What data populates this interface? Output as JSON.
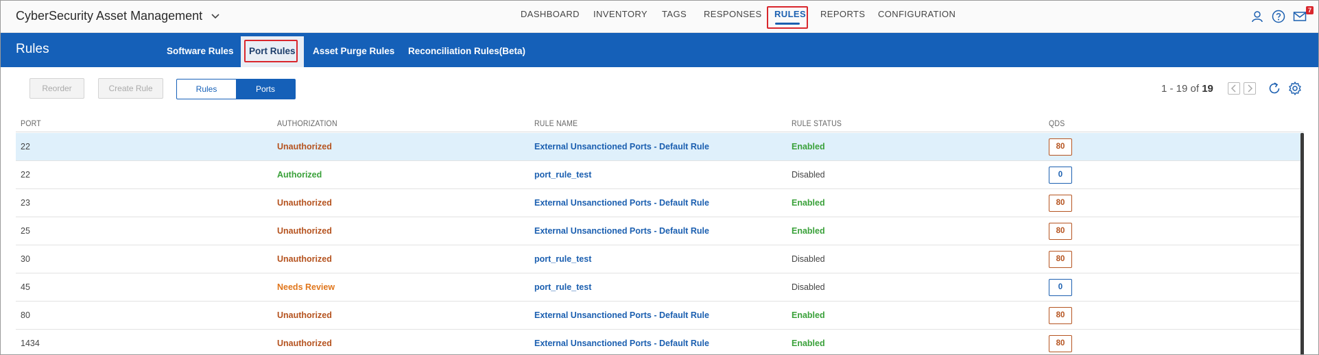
{
  "app": {
    "title": "CyberSecurity Asset Management"
  },
  "nav": {
    "items": [
      "DASHBOARD",
      "INVENTORY",
      "TAGS",
      "RESPONSES",
      "RULES",
      "REPORTS",
      "CONFIGURATION"
    ],
    "active": "RULES"
  },
  "header_icons": [
    "user-icon",
    "help-icon",
    "mail-icon"
  ],
  "notifications": {
    "count": "7"
  },
  "section": {
    "title": "Rules"
  },
  "subtabs": {
    "items": [
      "Software Rules",
      "Port Rules",
      "Asset Purge Rules",
      "Reconciliation Rules(Beta)"
    ],
    "active": "Port Rules"
  },
  "toolbar": {
    "reorder_label": "Reorder",
    "create_rule_label": "Create Rule",
    "toggle": {
      "options": [
        "Rules",
        "Ports"
      ],
      "active": "Ports"
    }
  },
  "pager": {
    "range": "1 - 19 of",
    "total": "19"
  },
  "table": {
    "columns": [
      "PORT",
      "AUTHORIZATION",
      "RULE NAME",
      "RULE STATUS",
      "QDS"
    ],
    "rows": [
      {
        "port": "22",
        "authorization": "Unauthorized",
        "rule_name": "External Unsanctioned Ports - Default Rule",
        "status": "Enabled",
        "qds": "80",
        "selected": true
      },
      {
        "port": "22",
        "authorization": "Authorized",
        "rule_name": "port_rule_test",
        "status": "Disabled",
        "qds": "0"
      },
      {
        "port": "23",
        "authorization": "Unauthorized",
        "rule_name": "External Unsanctioned Ports - Default Rule",
        "status": "Enabled",
        "qds": "80"
      },
      {
        "port": "25",
        "authorization": "Unauthorized",
        "rule_name": "External Unsanctioned Ports - Default Rule",
        "status": "Enabled",
        "qds": "80"
      },
      {
        "port": "30",
        "authorization": "Unauthorized",
        "rule_name": "port_rule_test",
        "status": "Disabled",
        "qds": "80"
      },
      {
        "port": "45",
        "authorization": "Needs Review",
        "rule_name": "port_rule_test",
        "status": "Disabled",
        "qds": "0"
      },
      {
        "port": "80",
        "authorization": "Unauthorized",
        "rule_name": "External Unsanctioned Ports - Default Rule",
        "status": "Enabled",
        "qds": "80"
      },
      {
        "port": "1434",
        "authorization": "Unauthorized",
        "rule_name": "External Unsanctioned Ports - Default Rule",
        "status": "Enabled",
        "qds": "80"
      }
    ]
  },
  "colors": {
    "brand_blue": "#1560b8",
    "highlight_red": "#d9262c",
    "unauthorized": "#b5531f",
    "authorized": "#3aa13a",
    "needs_review": "#e0761c",
    "selected_row": "#dff0fb"
  }
}
